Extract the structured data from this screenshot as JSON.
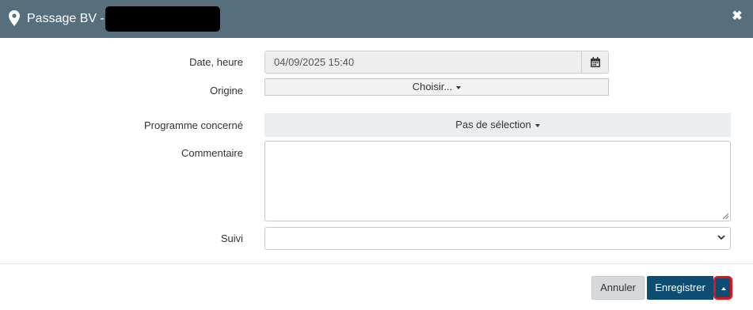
{
  "header": {
    "title": "Passage BV -",
    "icons": {
      "location": "map-marker-icon",
      "close": "close-icon"
    },
    "background": "#576f7c"
  },
  "form": {
    "date": {
      "label": "Date, heure",
      "value": "04/09/2025 15:40",
      "icon": "calendar-icon"
    },
    "origine": {
      "label": "Origine",
      "button": "Choisir..."
    },
    "programme": {
      "label": "Programme concerné",
      "button": "Pas de sélection"
    },
    "commentaire": {
      "label": "Commentaire",
      "value": ""
    },
    "suivi": {
      "label": "Suivi",
      "value": ""
    }
  },
  "footer": {
    "cancel_label": "Annuler",
    "save_label": "Enregistrer",
    "save_color": "#0d4d73",
    "highlight_color": "#e8101a"
  }
}
